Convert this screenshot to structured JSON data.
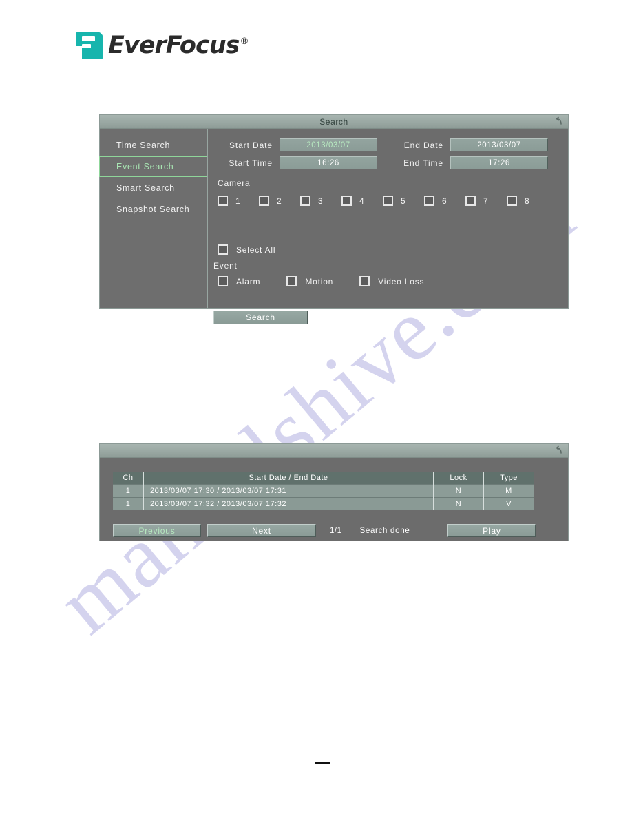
{
  "brand": {
    "name": "EverFocus",
    "registered_mark": "®",
    "logo_icon": "everfocus-logo-icon",
    "accent_color": "#17b5ad"
  },
  "watermark": {
    "text": "manualshive.com",
    "color": "#706ec6"
  },
  "search_dialog": {
    "title": "Search",
    "back_icon": "back-arrow-icon",
    "sidebar": {
      "items": [
        {
          "label": "Time Search",
          "active": false
        },
        {
          "label": "Event Search",
          "active": true
        },
        {
          "label": "Smart Search",
          "active": false
        },
        {
          "label": "Snapshot Search",
          "active": false
        }
      ]
    },
    "fields": {
      "start_date": {
        "label": "Start Date",
        "value": "2013/03/07",
        "focused": true
      },
      "start_time": {
        "label": "Start Time",
        "value": "16:26",
        "focused": false
      },
      "end_date": {
        "label": "End Date",
        "value": "2013/03/07",
        "focused": false
      },
      "end_time": {
        "label": "End Time",
        "value": "17:26",
        "focused": false
      }
    },
    "camera": {
      "label": "Camera",
      "channels": [
        {
          "number": "1",
          "checked": false
        },
        {
          "number": "2",
          "checked": false
        },
        {
          "number": "3",
          "checked": false
        },
        {
          "number": "4",
          "checked": false
        },
        {
          "number": "5",
          "checked": false
        },
        {
          "number": "6",
          "checked": false
        },
        {
          "number": "7",
          "checked": false
        },
        {
          "number": "8",
          "checked": false
        }
      ]
    },
    "select_all": {
      "label": "Select All",
      "checked": false
    },
    "event": {
      "label": "Event",
      "options": [
        {
          "label": "Alarm",
          "checked": false
        },
        {
          "label": "Motion",
          "checked": false
        },
        {
          "label": "Video Loss",
          "checked": false
        }
      ]
    },
    "submit_button": {
      "label": "Search",
      "focused": false
    }
  },
  "results_dialog": {
    "back_icon": "back-arrow-icon",
    "table": {
      "columns": [
        "Ch",
        "Start Date / End Date",
        "Lock",
        "Type"
      ],
      "rows": [
        {
          "ch": "1",
          "range": "2013/03/07 17:30  /  2013/03/07  17:31",
          "lock": "N",
          "type": "M"
        },
        {
          "ch": "1",
          "range": "2013/03/07 17:32  /  2013/03/07  17:32",
          "lock": "N",
          "type": "V"
        }
      ]
    },
    "footer": {
      "previous_button": {
        "label": "Previous",
        "focused": true
      },
      "next_button": {
        "label": "Next",
        "focused": false
      },
      "page_indicator": "1/1",
      "status": "Search done",
      "play_button": {
        "label": "Play",
        "focused": false
      }
    }
  }
}
